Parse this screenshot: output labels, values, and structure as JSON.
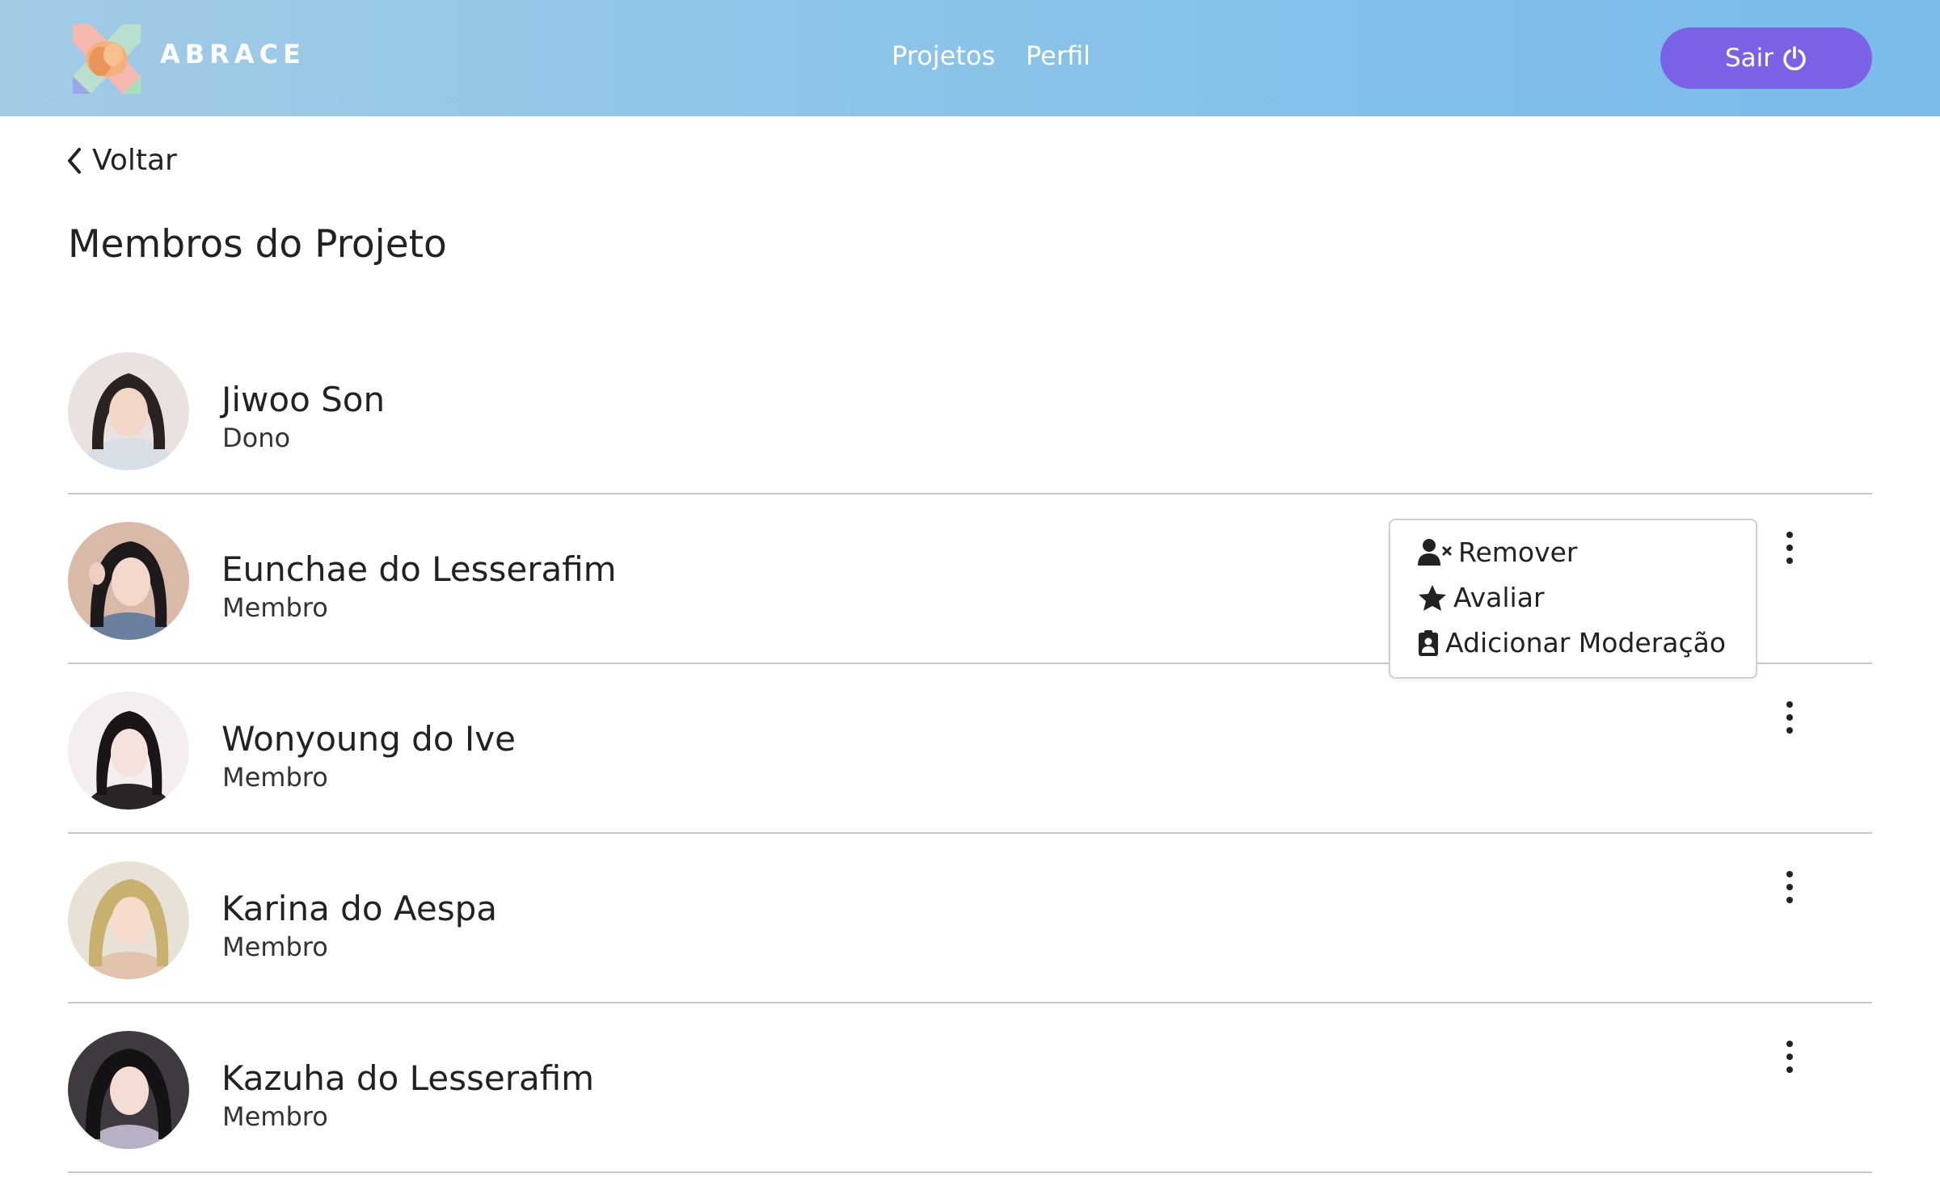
{
  "header": {
    "brand": "ABRACE",
    "nav": [
      "Projetos",
      "Perfil"
    ],
    "logout_label": "Sair"
  },
  "back_label": "Voltar",
  "page_title": "Membros do Projeto",
  "members": [
    {
      "name": "Jiwoo Son",
      "role": "Dono"
    },
    {
      "name": "Eunchae do Lesserafim",
      "role": "Membro"
    },
    {
      "name": "Wonyoung do Ive",
      "role": "Membro"
    },
    {
      "name": "Karina do Aespa",
      "role": "Membro"
    },
    {
      "name": "Kazuha do Lesserafim",
      "role": "Membro"
    }
  ],
  "member_menu": {
    "items": [
      "Remover",
      "Avaliar",
      "Adicionar Moderação"
    ]
  },
  "colors": {
    "accent": "#7b61e6",
    "header_start": "#a2cbe6",
    "header_end": "#79bbea"
  }
}
